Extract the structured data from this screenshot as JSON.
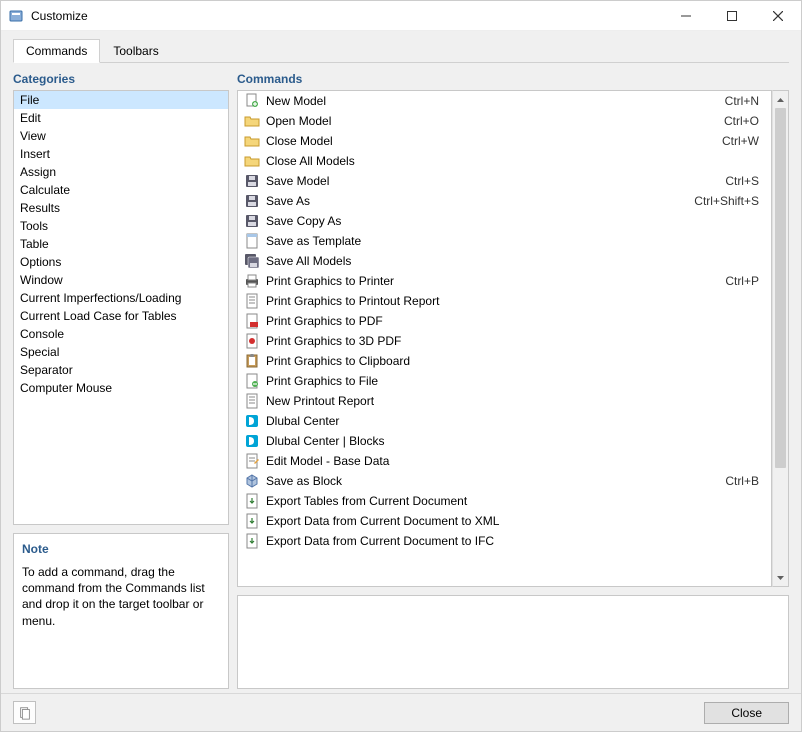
{
  "window": {
    "title": "Customize"
  },
  "tabs": [
    {
      "label": "Commands",
      "active": true
    },
    {
      "label": "Toolbars",
      "active": false
    }
  ],
  "categories": {
    "header": "Categories",
    "items": [
      {
        "label": "File",
        "selected": true
      },
      {
        "label": "Edit"
      },
      {
        "label": "View"
      },
      {
        "label": "Insert"
      },
      {
        "label": "Assign"
      },
      {
        "label": "Calculate"
      },
      {
        "label": "Results"
      },
      {
        "label": "Tools"
      },
      {
        "label": "Table"
      },
      {
        "label": "Options"
      },
      {
        "label": "Window"
      },
      {
        "label": "Current Imperfections/Loading"
      },
      {
        "label": "Current Load Case for Tables"
      },
      {
        "label": "Console"
      },
      {
        "label": "Special"
      },
      {
        "label": "Separator"
      },
      {
        "label": "Computer Mouse"
      }
    ]
  },
  "note": {
    "header": "Note",
    "text": "To add a command, drag the command from the Commands list and drop it on the target toolbar or menu."
  },
  "commands": {
    "header": "Commands",
    "items": [
      {
        "icon": "doc-new",
        "label": "New Model",
        "shortcut": "Ctrl+N"
      },
      {
        "icon": "folder-open",
        "label": "Open Model",
        "shortcut": "Ctrl+O"
      },
      {
        "icon": "folder-open",
        "label": "Close Model",
        "shortcut": "Ctrl+W"
      },
      {
        "icon": "folder-open",
        "label": "Close All Models",
        "shortcut": ""
      },
      {
        "icon": "disk",
        "label": "Save Model",
        "shortcut": "Ctrl+S"
      },
      {
        "icon": "disk",
        "label": "Save As",
        "shortcut": "Ctrl+Shift+S"
      },
      {
        "icon": "disk",
        "label": "Save Copy As",
        "shortcut": ""
      },
      {
        "icon": "template",
        "label": "Save as Template",
        "shortcut": ""
      },
      {
        "icon": "disk-multi",
        "label": "Save All Models",
        "shortcut": ""
      },
      {
        "icon": "printer",
        "label": "Print Graphics to Printer",
        "shortcut": "Ctrl+P"
      },
      {
        "icon": "doc-report",
        "label": "Print Graphics to Printout Report",
        "shortcut": ""
      },
      {
        "icon": "doc-pdf",
        "label": "Print Graphics to PDF",
        "shortcut": ""
      },
      {
        "icon": "doc-3d",
        "label": "Print Graphics to 3D PDF",
        "shortcut": ""
      },
      {
        "icon": "clipboard",
        "label": "Print Graphics to Clipboard",
        "shortcut": ""
      },
      {
        "icon": "doc-file",
        "label": "Print Graphics to File",
        "shortcut": ""
      },
      {
        "icon": "doc-report",
        "label": "New Printout Report",
        "shortcut": ""
      },
      {
        "icon": "dlubal",
        "label": "Dlubal Center",
        "shortcut": ""
      },
      {
        "icon": "dlubal",
        "label": "Dlubal Center | Blocks",
        "shortcut": ""
      },
      {
        "icon": "doc-edit",
        "label": "Edit Model - Base Data",
        "shortcut": ""
      },
      {
        "icon": "block",
        "label": "Save as Block",
        "shortcut": "Ctrl+B"
      },
      {
        "icon": "export",
        "label": "Export Tables from Current Document",
        "shortcut": ""
      },
      {
        "icon": "export",
        "label": "Export Data from Current Document to XML",
        "shortcut": ""
      },
      {
        "icon": "export",
        "label": "Export Data from Current Document to IFC",
        "shortcut": ""
      }
    ]
  },
  "footer": {
    "close": "Close"
  }
}
